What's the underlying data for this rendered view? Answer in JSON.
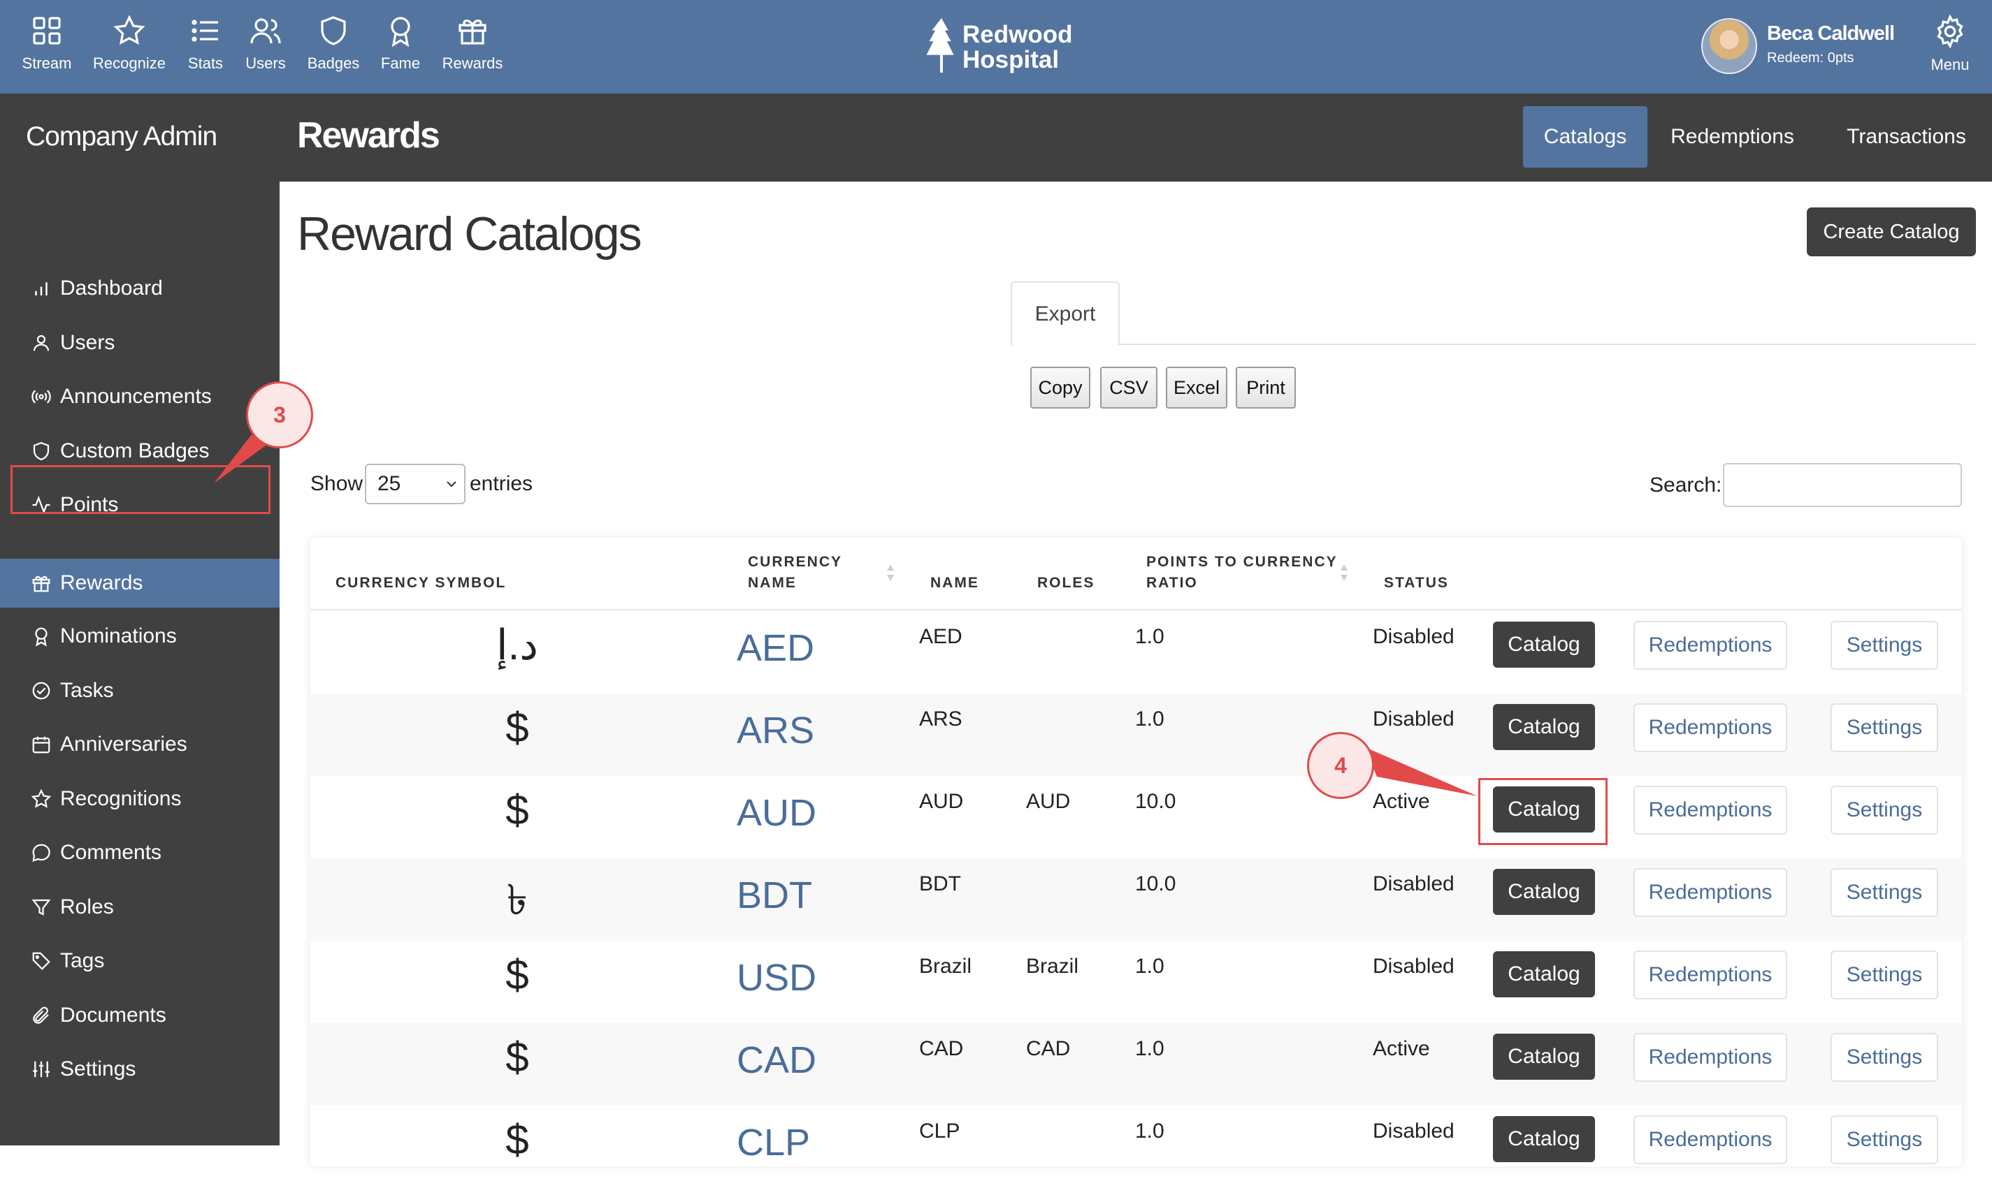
{
  "topnav": {
    "items": [
      {
        "label": "Stream",
        "icon": "grid-icon"
      },
      {
        "label": "Recognize",
        "icon": "star-icon"
      },
      {
        "label": "Stats",
        "icon": "list-icon"
      },
      {
        "label": "Users",
        "icon": "users-icon"
      },
      {
        "label": "Badges",
        "icon": "shield-icon"
      },
      {
        "label": "Fame",
        "icon": "award-icon"
      },
      {
        "label": "Rewards",
        "icon": "gift-icon"
      }
    ],
    "brand_line1": "Redwood",
    "brand_line2": "Hospital",
    "user_name": "Beca Caldwell",
    "user_sub": "Redeem: 0pts",
    "menu_label": "Menu"
  },
  "sidebar": {
    "title": "Company Admin",
    "items": [
      {
        "label": "Dashboard",
        "icon": "bar-chart-icon"
      },
      {
        "label": "Users",
        "icon": "user-icon"
      },
      {
        "label": "Announcements",
        "icon": "broadcast-icon"
      },
      {
        "label": "Custom Badges",
        "icon": "shield-icon"
      },
      {
        "label": "Points",
        "icon": "activity-icon"
      },
      {
        "label": "Rewards",
        "icon": "gift-icon"
      },
      {
        "label": "Nominations",
        "icon": "award-icon"
      },
      {
        "label": "Tasks",
        "icon": "check-circle-icon"
      },
      {
        "label": "Anniversaries",
        "icon": "calendar-icon"
      },
      {
        "label": "Recognitions",
        "icon": "star-icon"
      },
      {
        "label": "Comments",
        "icon": "chat-icon"
      },
      {
        "label": "Roles",
        "icon": "filter-icon"
      },
      {
        "label": "Tags",
        "icon": "tag-icon"
      },
      {
        "label": "Documents",
        "icon": "paperclip-icon"
      },
      {
        "label": "Settings",
        "icon": "sliders-icon"
      }
    ],
    "active_index": 5
  },
  "header": {
    "title": "Rewards",
    "tabs": [
      {
        "label": "Catalogs",
        "active": true
      },
      {
        "label": "Redemptions",
        "active": false
      },
      {
        "label": "Transactions",
        "active": false
      }
    ]
  },
  "main": {
    "heading": "Reward Catalogs",
    "create_button": "Create Catalog",
    "export_tab": "Export",
    "export_buttons": [
      "Copy",
      "CSV",
      "Excel",
      "Print"
    ],
    "show_label": "Show",
    "show_value": "25",
    "entries_label": "entries",
    "search_label": "Search:",
    "search_value": ""
  },
  "table": {
    "columns": {
      "symbol": "CURRENCY SYMBOL",
      "currency_name_1": "CURRENCY",
      "currency_name_2": "NAME",
      "name": "NAME",
      "roles": "ROLES",
      "ratio_1": "POINTS TO CURRENCY",
      "ratio_2": "RATIO",
      "status": "STATUS"
    },
    "rows": [
      {
        "symbol": "د.إ",
        "code": "AED",
        "name": "AED",
        "roles": "",
        "ratio": "1.0",
        "status": "Disabled"
      },
      {
        "symbol": "$",
        "code": "ARS",
        "name": "ARS",
        "roles": "",
        "ratio": "1.0",
        "status": "Disabled"
      },
      {
        "symbol": "$",
        "code": "AUD",
        "name": "AUD",
        "roles": "AUD",
        "ratio": "10.0",
        "status": "Active"
      },
      {
        "symbol": "৳",
        "code": "BDT",
        "name": "BDT",
        "roles": "",
        "ratio": "10.0",
        "status": "Disabled"
      },
      {
        "symbol": "$",
        "code": "USD",
        "name": "Brazil",
        "roles": "Brazil",
        "ratio": "1.0",
        "status": "Disabled"
      },
      {
        "symbol": "$",
        "code": "CAD",
        "name": "CAD",
        "roles": "CAD",
        "ratio": "1.0",
        "status": "Active"
      },
      {
        "symbol": "$",
        "code": "CLP",
        "name": "CLP",
        "roles": "",
        "ratio": "1.0",
        "status": "Disabled"
      }
    ],
    "action_catalog": "Catalog",
    "action_redemptions": "Redemptions",
    "action_settings": "Settings"
  },
  "annotations": {
    "step_a": "3",
    "step_b": "4",
    "color": "#e24a4a"
  },
  "colors": {
    "topbar": "#5474a0",
    "dark": "#404040",
    "link": "#4a6d9a"
  }
}
